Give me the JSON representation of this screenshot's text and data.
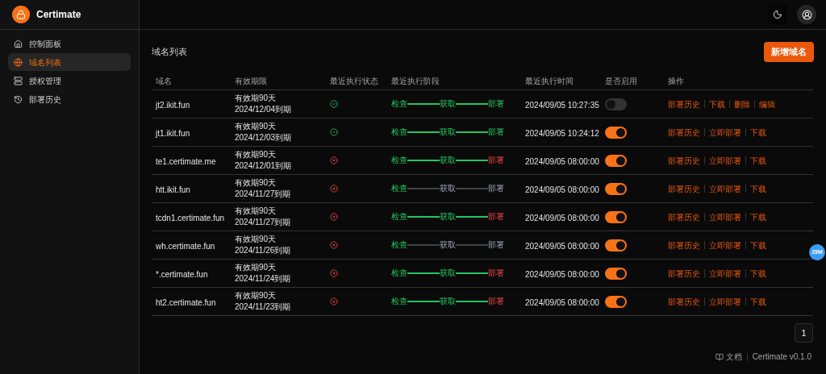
{
  "brand": {
    "name": "Certimate"
  },
  "sidebar": {
    "items": [
      {
        "label": "控制面板",
        "selected": false
      },
      {
        "label": "域名列表",
        "selected": true
      },
      {
        "label": "授权管理",
        "selected": false
      },
      {
        "label": "部署历史",
        "selected": false
      }
    ]
  },
  "page": {
    "title": "域名列表",
    "add_button": "新增域名"
  },
  "table": {
    "columns": [
      "域名",
      "有效期限",
      "最近执行状态",
      "最近执行阶段",
      "最近执行时间",
      "是否启用",
      "操作"
    ],
    "rows": [
      {
        "domain": "jt2.ikit.fun",
        "validity": "有效期90天",
        "expiry": "2024/12/04到期",
        "succeeded": true,
        "stages": [
          {
            "label": "检查",
            "reached": true,
            "failed": false
          },
          {
            "label": "获取",
            "reached": true,
            "failed": false
          },
          {
            "label": "部署",
            "reached": true,
            "failed": false
          }
        ],
        "time": "2024/09/05 10:27:35",
        "enabled": false,
        "actions": [
          "部署历史",
          "下载",
          "删除",
          "编辑"
        ]
      },
      {
        "domain": "jt1.ikit.fun",
        "validity": "有效期90天",
        "expiry": "2024/12/03到期",
        "succeeded": true,
        "stages": [
          {
            "label": "检查",
            "reached": true,
            "failed": false
          },
          {
            "label": "获取",
            "reached": true,
            "failed": false
          },
          {
            "label": "部署",
            "reached": true,
            "failed": false
          }
        ],
        "time": "2024/09/05 10:24:12",
        "enabled": true,
        "actions": [
          "部署历史",
          "立即部署",
          "下载"
        ]
      },
      {
        "domain": "te1.certimate.me",
        "validity": "有效期90天",
        "expiry": "2024/12/01到期",
        "succeeded": false,
        "stages": [
          {
            "label": "检查",
            "reached": true,
            "failed": false
          },
          {
            "label": "获取",
            "reached": true,
            "failed": false
          },
          {
            "label": "部署",
            "reached": true,
            "failed": true
          }
        ],
        "time": "2024/09/05 08:00:00",
        "enabled": true,
        "actions": [
          "部署历史",
          "立即部署",
          "下载"
        ]
      },
      {
        "domain": "htt.ikit.fun",
        "validity": "有效期90天",
        "expiry": "2024/11/27到期",
        "succeeded": false,
        "stages": [
          {
            "label": "检查",
            "reached": true,
            "failed": false
          },
          {
            "label": "获取",
            "reached": false,
            "failed": false
          },
          {
            "label": "部署",
            "reached": false,
            "failed": false
          }
        ],
        "time": "2024/09/05 08:00:00",
        "enabled": true,
        "actions": [
          "部署历史",
          "立即部署",
          "下载"
        ]
      },
      {
        "domain": "tcdn1.certimate.fun",
        "validity": "有效期90天",
        "expiry": "2024/11/27到期",
        "succeeded": false,
        "stages": [
          {
            "label": "检查",
            "reached": true,
            "failed": false
          },
          {
            "label": "获取",
            "reached": true,
            "failed": false
          },
          {
            "label": "部署",
            "reached": true,
            "failed": true
          }
        ],
        "time": "2024/09/05 08:00:00",
        "enabled": true,
        "actions": [
          "部署历史",
          "立即部署",
          "下载"
        ]
      },
      {
        "domain": "wh.certimate.fun",
        "validity": "有效期90天",
        "expiry": "2024/11/26到期",
        "succeeded": false,
        "stages": [
          {
            "label": "检查",
            "reached": true,
            "failed": false
          },
          {
            "label": "获取",
            "reached": false,
            "failed": false
          },
          {
            "label": "部署",
            "reached": false,
            "failed": false
          }
        ],
        "time": "2024/09/05 08:00:00",
        "enabled": true,
        "actions": [
          "部署历史",
          "立即部署",
          "下载"
        ]
      },
      {
        "domain": "*.certimate.fun",
        "validity": "有效期90天",
        "expiry": "2024/11/24到期",
        "succeeded": false,
        "stages": [
          {
            "label": "检查",
            "reached": true,
            "failed": false
          },
          {
            "label": "获取",
            "reached": true,
            "failed": false
          },
          {
            "label": "部署",
            "reached": true,
            "failed": true
          }
        ],
        "time": "2024/09/05 08:00:00",
        "enabled": true,
        "actions": [
          "部署历史",
          "立即部署",
          "下载"
        ]
      },
      {
        "domain": "ht2.certimate.fun",
        "validity": "有效期90天",
        "expiry": "2024/11/23到期",
        "succeeded": false,
        "stages": [
          {
            "label": "检查",
            "reached": true,
            "failed": false
          },
          {
            "label": "获取",
            "reached": true,
            "failed": false
          },
          {
            "label": "部署",
            "reached": true,
            "failed": true
          }
        ],
        "time": "2024/09/05 08:00:00",
        "enabled": true,
        "actions": [
          "部署历史",
          "立即部署",
          "下载"
        ]
      }
    ]
  },
  "pagination": {
    "pages": [
      {
        "label": "1",
        "selected": true
      }
    ]
  },
  "floating_badge": "29M",
  "footer": {
    "docs": "文档",
    "version": "Certimate v0.1.0"
  }
}
